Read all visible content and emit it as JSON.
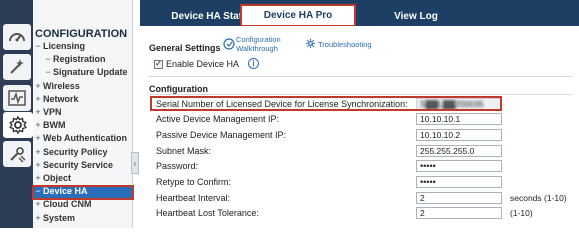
{
  "rail": {
    "icons": [
      "dashboard-icon",
      "monitor-wand-icon",
      "activity-graph-icon",
      "settings-gear-icon",
      "maintenance-icon"
    ]
  },
  "nav": {
    "title": "CONFIGURATION",
    "items": [
      {
        "sym": "−",
        "label": "Licensing"
      },
      {
        "sym": "−",
        "label": "Registration",
        "sub": true
      },
      {
        "sym": "−",
        "label": "Signature Update",
        "sub": true
      },
      {
        "sym": "+",
        "label": "Wireless"
      },
      {
        "sym": "+",
        "label": "Network"
      },
      {
        "sym": "+",
        "label": "VPN"
      },
      {
        "sym": "+",
        "label": "BWM"
      },
      {
        "sym": "+",
        "label": "Web Authentication"
      },
      {
        "sym": "+",
        "label": "Security Policy"
      },
      {
        "sym": "+",
        "label": "Security Service"
      },
      {
        "sym": "+",
        "label": "Object"
      },
      {
        "sym": "−",
        "label": "Device HA",
        "active": true
      },
      {
        "sym": "+",
        "label": "Cloud CNM"
      },
      {
        "sym": "+",
        "label": "System"
      }
    ],
    "collapse_glyph": "‹"
  },
  "tabs": [
    {
      "label": "Device HA Status",
      "active": false
    },
    {
      "label": "Device HA Pro",
      "active": true
    },
    {
      "label": "View Log",
      "active": false
    }
  ],
  "general": {
    "title": "General Settings",
    "config_walkthrough": "Configuration\nWalkthrough",
    "troubleshooting": "Troubleshooting",
    "enable_label": "Enable Device HA",
    "enable_checked": true
  },
  "configuration": {
    "title": "Configuration",
    "fields": [
      {
        "label": "Serial Number of Licensed Device for License Synchronization:",
        "value": "S▓▓L▓▓200035",
        "readonly": true,
        "blurred": true,
        "highlight": true
      },
      {
        "label": "Active Device Management IP:",
        "value": "10.10.10.1"
      },
      {
        "label": "Passive Device Management IP:",
        "value": "10.10.10.2"
      },
      {
        "label": "Subnet Mask:",
        "value": "255.255.255.0"
      },
      {
        "label": "Password:",
        "value": "•••••"
      },
      {
        "label": "Retype to Confirm:",
        "value": "•••••"
      },
      {
        "label": "Heartbeat Interval:",
        "value": "2",
        "hint": "seconds (1-10)"
      },
      {
        "label": "Heartbeat Lost Tolerance:",
        "value": "2",
        "hint": "(1-10)"
      }
    ]
  },
  "colors": {
    "rail_bg": "#2c3d55",
    "tab_bar_bg": "#1d3f63",
    "nav_active_bg": "#2a6db8",
    "highlight_border": "#c0392b",
    "link": "#2a6db8"
  }
}
